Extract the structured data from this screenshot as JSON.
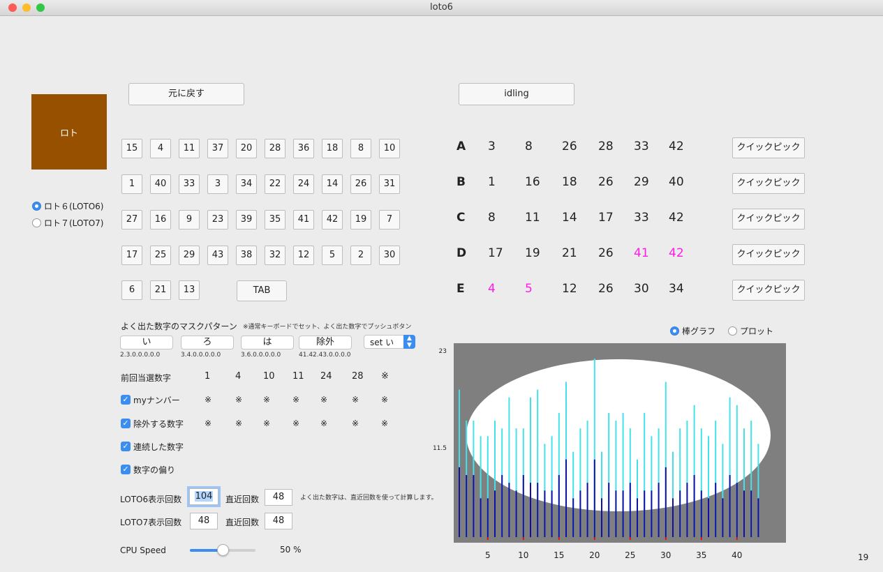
{
  "window": {
    "title": "loto6"
  },
  "toolbar": {
    "undo_label": "元に戻す",
    "status_label": "idling"
  },
  "logo": {
    "label": "ロト",
    "color": "#965000"
  },
  "game_select": [
    {
      "label": "ロト６(LOTO6)",
      "selected": true
    },
    {
      "label": "ロト７(LOTO7)",
      "selected": false
    }
  ],
  "number_grid": [
    [
      "15",
      "4",
      "11",
      "37",
      "20",
      "28",
      "36",
      "18",
      "8",
      "10"
    ],
    [
      "1",
      "40",
      "33",
      "3",
      "34",
      "22",
      "24",
      "14",
      "26",
      "31"
    ],
    [
      "27",
      "16",
      "9",
      "23",
      "39",
      "35",
      "41",
      "42",
      "19",
      "7"
    ],
    [
      "17",
      "25",
      "29",
      "43",
      "38",
      "32",
      "12",
      "5",
      "2",
      "30"
    ],
    [
      "6",
      "21",
      "13"
    ]
  ],
  "tab_label": "TAB",
  "picks": [
    {
      "letter": "A",
      "numbers": [
        {
          "v": "3",
          "hot": false
        },
        {
          "v": "8",
          "hot": false
        },
        {
          "v": "26",
          "hot": false
        },
        {
          "v": "28",
          "hot": false
        },
        {
          "v": "33",
          "hot": false
        },
        {
          "v": "42",
          "hot": false
        }
      ]
    },
    {
      "letter": "B",
      "numbers": [
        {
          "v": "1",
          "hot": false
        },
        {
          "v": "16",
          "hot": false
        },
        {
          "v": "18",
          "hot": false
        },
        {
          "v": "26",
          "hot": false
        },
        {
          "v": "29",
          "hot": false
        },
        {
          "v": "40",
          "hot": false
        }
      ]
    },
    {
      "letter": "C",
      "numbers": [
        {
          "v": "8",
          "hot": false
        },
        {
          "v": "11",
          "hot": false
        },
        {
          "v": "14",
          "hot": false
        },
        {
          "v": "17",
          "hot": false
        },
        {
          "v": "33",
          "hot": false
        },
        {
          "v": "42",
          "hot": false
        }
      ]
    },
    {
      "letter": "D",
      "numbers": [
        {
          "v": "17",
          "hot": false
        },
        {
          "v": "19",
          "hot": false
        },
        {
          "v": "21",
          "hot": false
        },
        {
          "v": "26",
          "hot": false
        },
        {
          "v": "41",
          "hot": true
        },
        {
          "v": "42",
          "hot": true
        }
      ]
    },
    {
      "letter": "E",
      "numbers": [
        {
          "v": "4",
          "hot": true
        },
        {
          "v": "5",
          "hot": true
        },
        {
          "v": "12",
          "hot": false
        },
        {
          "v": "26",
          "hot": false
        },
        {
          "v": "30",
          "hot": false
        },
        {
          "v": "34",
          "hot": false
        }
      ]
    }
  ],
  "quick_pick_label": "クイックピック",
  "highlight_color": "#ff1ce8",
  "mask": {
    "title": "よく出た数字のマスクパターン",
    "note": "※通常キーボードでセット、よく出た数字でプッシュボタン",
    "buttons": [
      {
        "label": "い",
        "pattern": "2.3.0.0.0.0.0"
      },
      {
        "label": "ろ",
        "pattern": "3.4.0.0.0.0.0"
      },
      {
        "label": "は",
        "pattern": "3.6.0.0.0.0.0"
      },
      {
        "label": "除外",
        "pattern": "41.42.43.0.0.0.0"
      }
    ],
    "select_value": "set い"
  },
  "filters": {
    "last_label": "前回当選数字",
    "last_numbers": [
      "1",
      "4",
      "10",
      "11",
      "24",
      "28",
      "※"
    ],
    "my_label": "myナンバー",
    "my_values": [
      "※",
      "※",
      "※",
      "※",
      "※",
      "※",
      "※"
    ],
    "exclude_label": "除外する数字",
    "exclude_values": [
      "※",
      "※",
      "※",
      "※",
      "※",
      "※",
      "※"
    ],
    "consecutive_label": "連続した数字",
    "bias_label": "数字の偏り"
  },
  "counts": {
    "loto6_label": "LOTO6表示回数",
    "loto6_value": "104",
    "recent_label": "直近回数",
    "loto6_recent": "48",
    "note": "よく出た数字は、直近回数を使って計算します。",
    "loto7_label": "LOTO7表示回数",
    "loto7_value": "48",
    "loto7_recent": "48"
  },
  "cpu": {
    "label": "CPU Speed",
    "value": 50,
    "value_text": "50 %"
  },
  "chart_mode": [
    {
      "label": "棒グラフ",
      "selected": true
    },
    {
      "label": "プロット",
      "selected": false
    }
  ],
  "corner_number": "19",
  "chart_data": {
    "type": "bar",
    "x": [
      1,
      2,
      3,
      4,
      5,
      6,
      7,
      8,
      9,
      10,
      11,
      12,
      13,
      14,
      15,
      16,
      17,
      18,
      19,
      20,
      21,
      22,
      23,
      24,
      25,
      26,
      27,
      28,
      29,
      30,
      31,
      32,
      33,
      34,
      35,
      36,
      37,
      38,
      39,
      40,
      41,
      42,
      43
    ],
    "series": [
      {
        "values": [
          19,
          15,
          15,
          13,
          13,
          15,
          14,
          18,
          14,
          14,
          18,
          19,
          12,
          13,
          16,
          20,
          11,
          14,
          15,
          23,
          11,
          16,
          15,
          16,
          14,
          10,
          16,
          13,
          14,
          20,
          11,
          14,
          15,
          17,
          14,
          13,
          15,
          12,
          18,
          17,
          14,
          15,
          12
        ]
      },
      {
        "values": [
          9,
          8,
          8,
          5,
          5,
          6,
          8,
          7,
          6,
          8,
          7,
          7,
          6,
          6,
          8,
          10,
          5,
          6,
          7,
          10,
          5,
          7,
          6,
          6,
          7,
          5,
          6,
          6,
          7,
          9,
          5,
          6,
          7,
          8,
          6,
          5,
          7,
          5,
          8,
          7,
          6,
          6,
          5
        ]
      }
    ],
    "ylim": [
      0,
      23
    ],
    "yticks": [
      "23",
      "11.5"
    ],
    "xticks": [
      5,
      10,
      15,
      20,
      25,
      30,
      35,
      40
    ],
    "colors": {
      "background": "#7f7f7f",
      "overlay": "#ffffff",
      "primary": "#43e2ea",
      "secondary": "#1010a6",
      "marker": "#e01010"
    }
  }
}
